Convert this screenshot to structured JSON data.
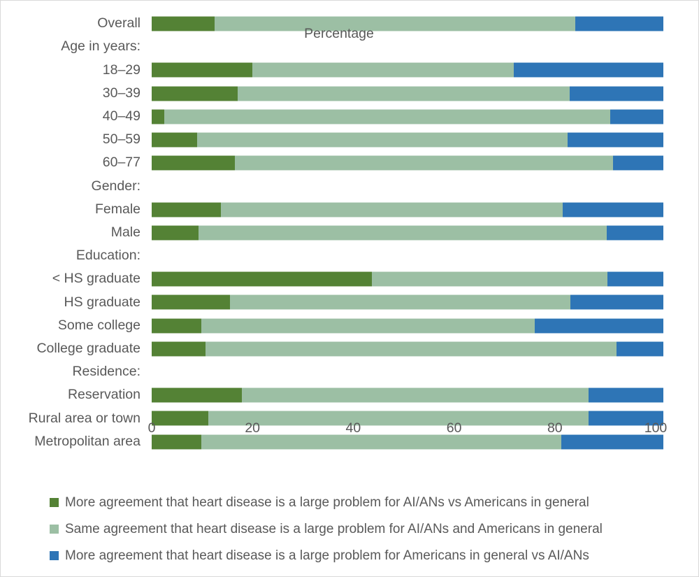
{
  "chart_data": {
    "type": "bar",
    "orientation": "horizontal",
    "stacked": true,
    "title": "",
    "xlabel": "Percentage",
    "ylabel": "",
    "xlim": [
      0,
      101.5
    ],
    "xticks": [
      "0",
      "20",
      "40",
      "60",
      "80",
      "100"
    ],
    "xtick_values": [
      0,
      20,
      40,
      60,
      80,
      100
    ],
    "grid": false,
    "legend_position": "bottom-left",
    "colors": {
      "more_ai_an": "#548235",
      "same": "#9CBFA4",
      "more_americans": "#2E75B6",
      "text": "#595959",
      "background": "#FFFFFF",
      "border": "#D9D9D9"
    },
    "series": [
      {
        "name": "More agreement that heart disease is a large problem for AI/ANs vs Americans in general",
        "color": "#548235"
      },
      {
        "name": "Same agreement that heart disease is a large problem for AI/ANs and Americans in general",
        "color": "#9CBFA4"
      },
      {
        "name": "More agreement that heart disease is a large problem for Americans in general vs AI/ANs",
        "color": "#2E75B6"
      }
    ],
    "rows": [
      {
        "label": "Overall",
        "type": "bar",
        "values": [
          12.5,
          71.5,
          17.5
        ]
      },
      {
        "label": "Age in years:",
        "type": "header",
        "values": []
      },
      {
        "label": "18–29",
        "type": "bar",
        "values": [
          20.0,
          51.8,
          29.7
        ]
      },
      {
        "label": "30–39",
        "type": "bar",
        "values": [
          17.0,
          66.0,
          18.5
        ]
      },
      {
        "label": "40–49",
        "type": "bar",
        "values": [
          2.5,
          88.5,
          10.5
        ]
      },
      {
        "label": "50–59",
        "type": "bar",
        "values": [
          9.0,
          73.5,
          19.0
        ]
      },
      {
        "label": "60–77",
        "type": "bar",
        "values": [
          16.5,
          75.0,
          10.0
        ]
      },
      {
        "label": "Gender:",
        "type": "header",
        "values": []
      },
      {
        "label": "Female",
        "type": "bar",
        "values": [
          13.7,
          67.9,
          19.9
        ]
      },
      {
        "label": "Male",
        "type": "bar",
        "values": [
          9.3,
          81.0,
          11.2
        ]
      },
      {
        "label": "Education:",
        "type": "header",
        "values": []
      },
      {
        "label": "< HS graduate",
        "type": "bar",
        "values": [
          43.7,
          46.7,
          11.1
        ]
      },
      {
        "label": "HS graduate",
        "type": "bar",
        "values": [
          15.5,
          67.6,
          18.4
        ]
      },
      {
        "label": "Some college",
        "type": "bar",
        "values": [
          9.8,
          66.2,
          25.5
        ]
      },
      {
        "label": "College graduate",
        "type": "bar",
        "values": [
          10.7,
          81.5,
          9.3
        ]
      },
      {
        "label": "Residence:",
        "type": "header",
        "values": []
      },
      {
        "label": "Reservation",
        "type": "bar",
        "values": [
          17.9,
          68.8,
          14.8
        ]
      },
      {
        "label": "Rural area or town",
        "type": "bar",
        "values": [
          11.2,
          75.5,
          14.8
        ]
      },
      {
        "label": "Metropolitan area",
        "type": "bar",
        "values": [
          9.8,
          71.5,
          20.2
        ]
      }
    ]
  },
  "axis": {
    "title": "Percentage",
    "ticks": [
      "0",
      "20",
      "40",
      "60",
      "80",
      "100"
    ]
  },
  "legend": {
    "items": [
      {
        "swatch": "dark-green-swatch",
        "label": "More agreement that heart disease is a large problem for AI/ANs vs Americans in general"
      },
      {
        "swatch": "light-green-swatch",
        "label": "Same agreement that heart disease is a large problem for AI/ANs and Americans in general"
      },
      {
        "swatch": "blue-swatch",
        "label": "More agreement that heart disease is a large problem for Americans in general vs AI/ANs"
      }
    ]
  }
}
